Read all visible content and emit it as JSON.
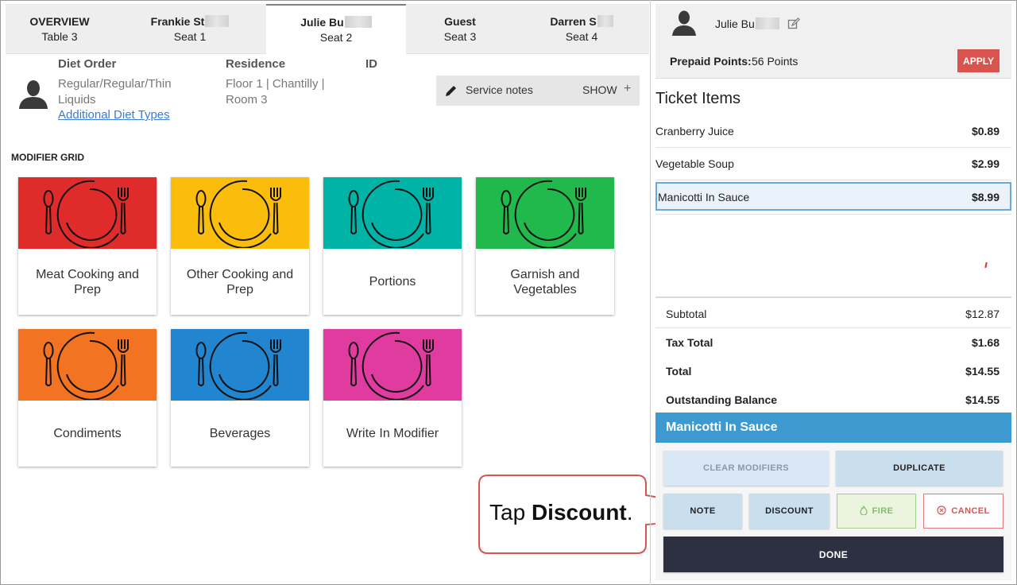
{
  "tabs": [
    {
      "title": "OVERVIEW",
      "sub": "Table 3",
      "active": false
    },
    {
      "title": "Frankie St",
      "sub": "Seat 1",
      "active": false
    },
    {
      "title": "Julie Bu",
      "sub": "Seat 2",
      "active": true
    },
    {
      "title": "Guest",
      "sub": "Seat 3",
      "active": false
    },
    {
      "title": "Darren S",
      "sub": "Seat 4",
      "active": false
    }
  ],
  "resident": {
    "diet_label": "Diet Order",
    "diet_value": "Regular/Regular/Thin Liquids",
    "additional_link": "Additional Diet Types",
    "residence_label": "Residence",
    "residence_value": "Floor 1 | Chantilly | Room 3",
    "id_label": "ID"
  },
  "service_notes": {
    "label": "Service notes",
    "toggle": "SHOW",
    "plus": "+"
  },
  "modifier_grid": {
    "title": "MODIFIER GRID",
    "tiles": [
      {
        "name": "Meat Cooking and Prep",
        "color": "#e02b2b"
      },
      {
        "name": "Other Cooking and Prep",
        "color": "#fbbd0b"
      },
      {
        "name": "Portions",
        "color": "#00b3a7"
      },
      {
        "name": "Garnish and Vegetables",
        "color": "#22b94c"
      },
      {
        "name": "Condiments",
        "color": "#f27322"
      },
      {
        "name": "Beverages",
        "color": "#2185d0"
      },
      {
        "name": "Write In Modifier",
        "color": "#e03b9e"
      }
    ]
  },
  "guest_header": {
    "name": "Julie Bu",
    "points_label": "Prepaid Points:",
    "points_value": "56 Points",
    "apply": "APPLY"
  },
  "ticket": {
    "title": "Ticket Items",
    "items": [
      {
        "name": "Cranberry Juice",
        "price": "$0.89"
      },
      {
        "name": "Vegetable Soup",
        "price": "$2.99"
      },
      {
        "name": "Manicotti In Sauce",
        "price": "$8.99",
        "selected": true
      }
    ]
  },
  "totals": {
    "subtotal_label": "Subtotal",
    "subtotal": "$12.87",
    "tax_label": "Tax Total",
    "tax": "$1.68",
    "total_label": "Total",
    "total": "$14.55",
    "balance_label": "Outstanding Balance",
    "balance": "$14.55"
  },
  "selected_item": "Manicotti In Sauce",
  "actions": {
    "clear": "CLEAR MODIFIERS",
    "duplicate": "DUPLICATE",
    "note": "NOTE",
    "discount": "DISCOUNT",
    "fire": "FIRE",
    "cancel": "CANCEL",
    "done": "DONE"
  },
  "callout": {
    "prefix": "Tap ",
    "bold": "Discount",
    "suffix": "."
  }
}
